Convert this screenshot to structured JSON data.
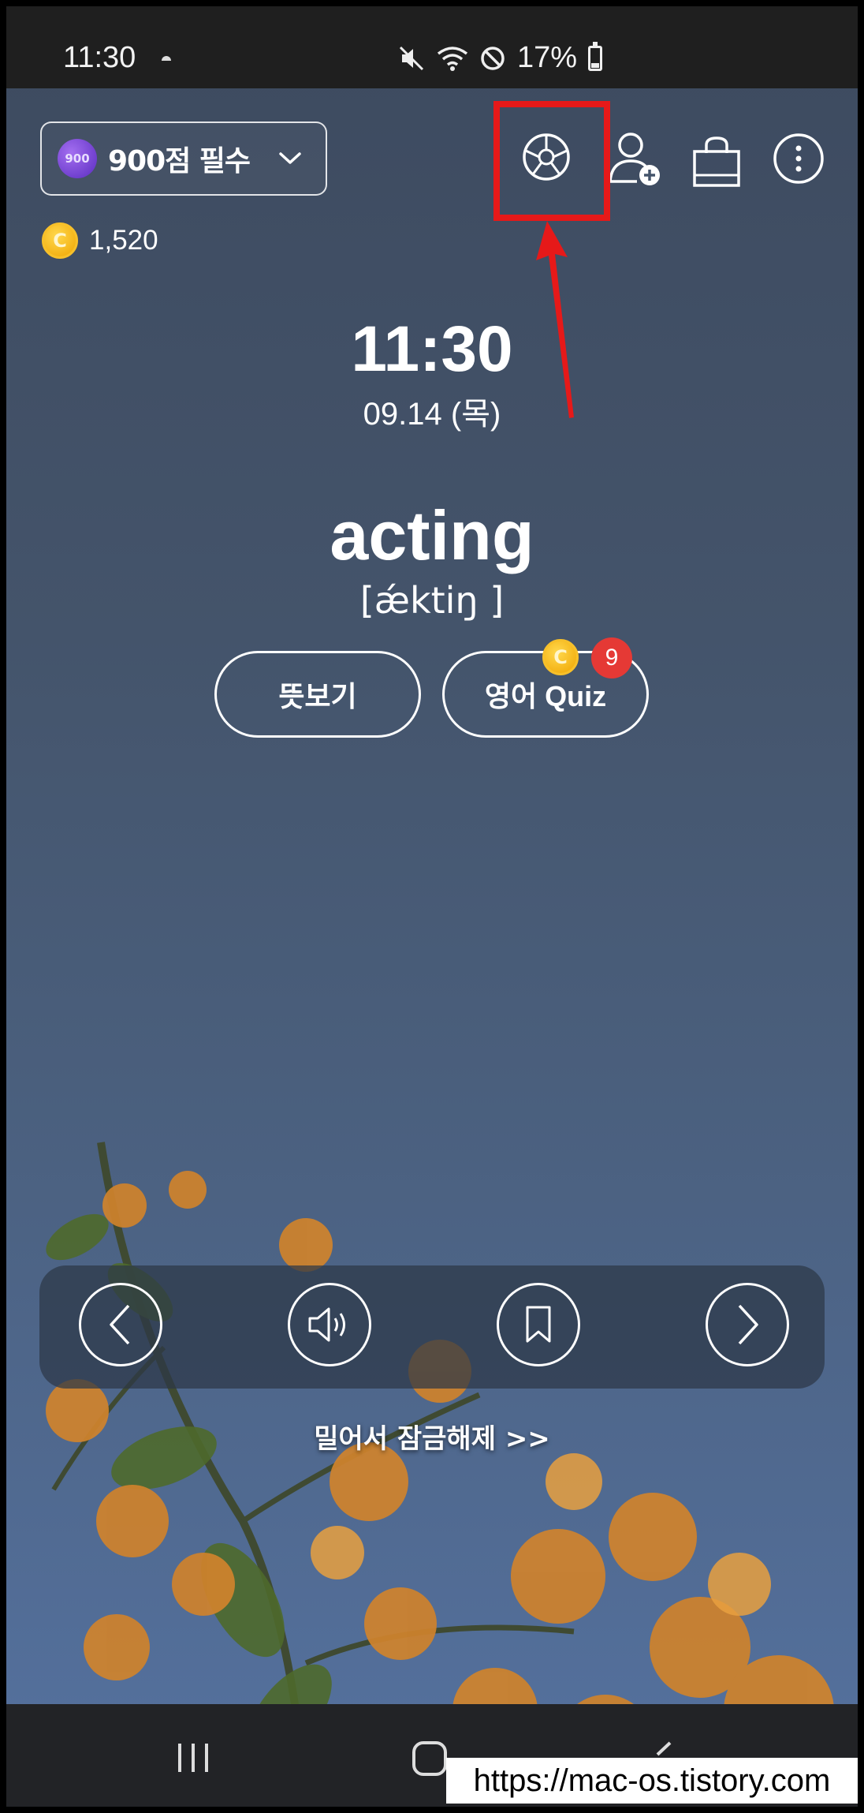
{
  "status_bar": {
    "time": "11:30",
    "battery": "17%"
  },
  "deck": {
    "badge": "900",
    "name": "900점 필수"
  },
  "coins": {
    "symbol": "C",
    "count": "1,520"
  },
  "lock_clock": {
    "time": "11:30",
    "date": "09.14 (목)"
  },
  "word_card": {
    "word": "acting",
    "pronunciation": "[ǽktiŋ ]"
  },
  "actions": {
    "meaning_label": "뜻보기",
    "quiz_label": "영어 Quiz",
    "quiz_coin_symbol": "C",
    "quiz_count": "9"
  },
  "unlock_hint": "밀어서 잠금해제 >>",
  "watermark": "https://mac-os.tistory.com",
  "colors": {
    "highlight": "#e61919",
    "badge_red": "#e53935",
    "coin": "#f0a500",
    "deck_badge": "#6a3cd0"
  },
  "icons": [
    "theme-wheel-icon",
    "add-person-icon",
    "shopping-bag-icon",
    "more-vertical-icon",
    "previous-icon",
    "speaker-icon",
    "bookmark-icon",
    "next-icon"
  ]
}
